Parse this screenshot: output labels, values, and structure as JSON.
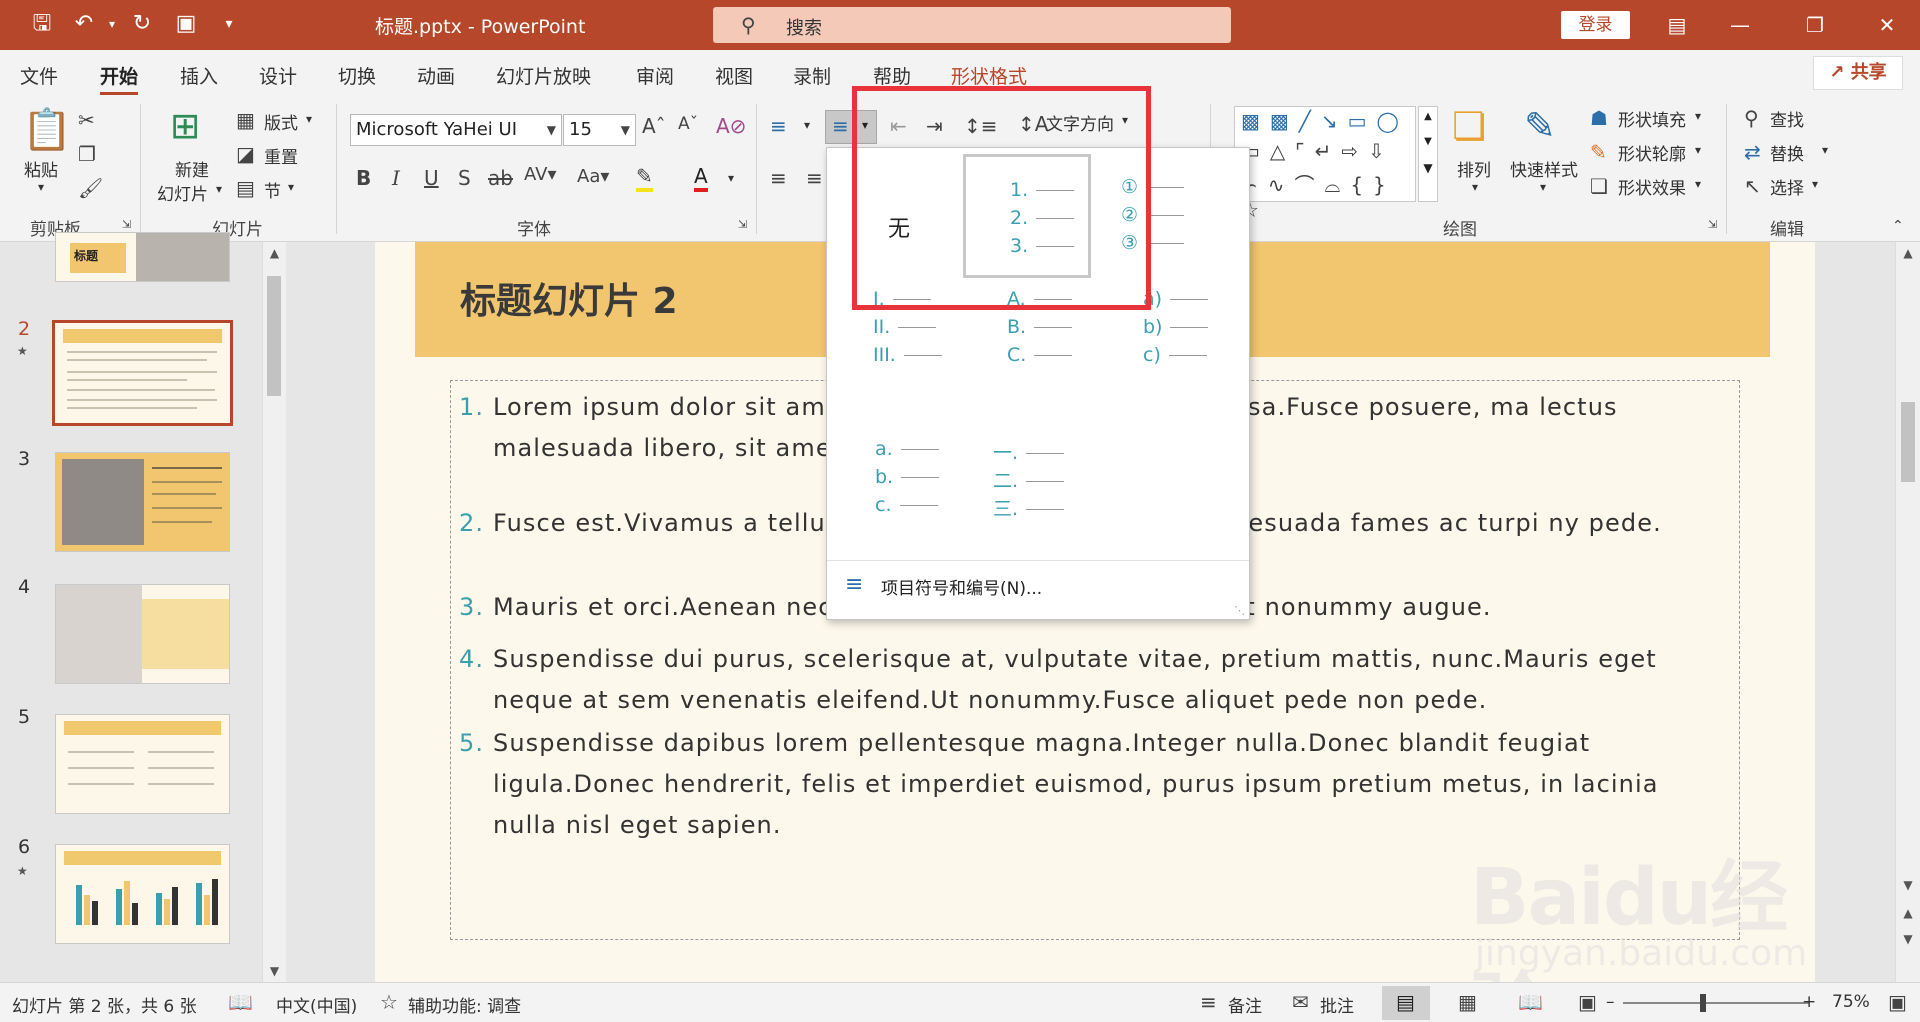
{
  "titlebar": {
    "title": "标题.pptx - PowerPoint",
    "search_placeholder": "搜索",
    "login": "登录"
  },
  "menu": {
    "tabs": [
      "文件",
      "开始",
      "插入",
      "设计",
      "切换",
      "动画",
      "幻灯片放映",
      "审阅",
      "视图",
      "录制",
      "帮助",
      "形状格式"
    ],
    "active": "开始",
    "share": "共享"
  },
  "ribbon": {
    "clipboard": {
      "paste": "粘贴",
      "group": "剪贴板"
    },
    "slides": {
      "new_slide_1": "新建",
      "new_slide_2": "幻灯片",
      "layout": "版式",
      "reset": "重置",
      "section": "节",
      "group": "幻灯片"
    },
    "font": {
      "name": "Microsoft YaHei UI",
      "size": "15",
      "group": "字体"
    },
    "paragraph": {
      "text_direction": "文字方向"
    },
    "drawing": {
      "arrange": "排列",
      "quick_styles": "快速样式",
      "shape_fill": "形状填充",
      "shape_outline": "形状轮廓",
      "shape_effects": "形状效果",
      "group": "绘图"
    },
    "editing": {
      "find": "查找",
      "replace": "替换",
      "select": "选择",
      "group": "编辑"
    }
  },
  "thumbnails": {
    "numbers": [
      "2",
      "3",
      "4",
      "5",
      "6"
    ],
    "active": "2",
    "partial_title": "标题"
  },
  "slide": {
    "title": "标题幻灯片 2",
    "bullets": [
      {
        "num": "1.",
        "text": "Lorem ipsum dolor sit am                                      Maecenas porttitor congue massa.Fusce posuere, ma                                      lectus malesuada libero, sit amet commodo magna eros qu                                      nim."
      },
      {
        "num": "2.",
        "text": "Fusce est.Vivamus a tellu                                      stique senectus et netus et malesuada fames ac turpi                                      ny pede."
      },
      {
        "num": "3.",
        "text": "Mauris et orci.Aenean nec lorem.In porttitor.Donec laoreet nonummy augue."
      },
      {
        "num": "4.",
        "text": "Suspendisse dui purus, scelerisque at, vulputate vitae, pretium mattis, nunc.Mauris eget neque at sem venenatis eleifend.Ut nonummy.Fusce aliquet pede non pede."
      },
      {
        "num": "5.",
        "text": "Suspendisse dapibus lorem pellentesque magna.Integer nulla.Donec blandit feugiat ligula.Donec hendrerit, felis et imperdiet euismod, purus ipsum pretium metus, in lacinia nulla nisl eget sapien."
      }
    ]
  },
  "numbering_menu": {
    "none_label": "无",
    "styles": [
      [
        "1.",
        "2.",
        "3."
      ],
      [
        "①",
        "②",
        "③"
      ],
      [
        "I.",
        "II.",
        "III."
      ],
      [
        "A.",
        "B.",
        "C."
      ],
      [
        "a)",
        "b)",
        "c)"
      ],
      [
        "a.",
        "b.",
        "c."
      ],
      [
        "一.",
        "二.",
        "三."
      ]
    ],
    "more": "项目符号和编号(N)..."
  },
  "statusbar": {
    "slide_info": "幻灯片 第 2 张，共 6 张",
    "language": "中文(中国)",
    "accessibility": "辅助功能: 调查",
    "notes": "备注",
    "comments": "批注",
    "zoom": "75%"
  },
  "watermark": {
    "brand": "Baidu经验",
    "url": "jingyan.baidu.com"
  },
  "colors": {
    "accent": "#b7472a",
    "highlight": "#e8333a",
    "band": "#f1c66e",
    "number": "#3aa0b0"
  }
}
